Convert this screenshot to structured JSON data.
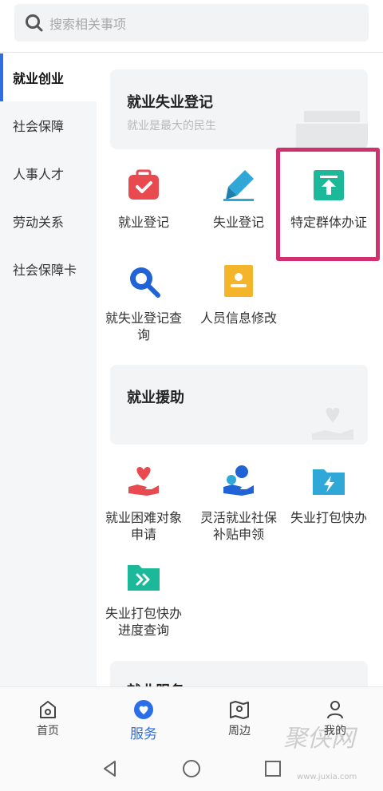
{
  "search": {
    "placeholder": "搜索相关事项"
  },
  "sidebar": {
    "items": [
      {
        "label": "就业创业"
      },
      {
        "label": "社会保障"
      },
      {
        "label": "人事人才"
      },
      {
        "label": "劳动关系"
      },
      {
        "label": "社会保障卡"
      }
    ]
  },
  "sections": {
    "registration": {
      "title": "就业失业登记",
      "subtitle": "就业是最大的民生",
      "items": [
        {
          "label": "就业登记",
          "icon": "briefcase-check-icon"
        },
        {
          "label": "失业登记",
          "icon": "pen-icon"
        },
        {
          "label": "特定群体办证",
          "icon": "upload-box-icon"
        },
        {
          "label": "就失业登记查询",
          "icon": "magnifier-icon"
        },
        {
          "label": "人员信息修改",
          "icon": "id-card-icon"
        }
      ]
    },
    "assistance": {
      "title": "就业援助",
      "items": [
        {
          "label": "就业困难对象申请",
          "icon": "hand-heart-icon"
        },
        {
          "label": "灵活就业社保补贴申领",
          "icon": "hand-coin-icon"
        },
        {
          "label": "失业打包快办",
          "icon": "folder-lightning-icon"
        },
        {
          "label": "失业打包快办进度查询",
          "icon": "folder-forward-icon"
        }
      ]
    },
    "service": {
      "title": "就业服务"
    }
  },
  "tabbar": {
    "tabs": [
      {
        "label": "首页"
      },
      {
        "label": "服务"
      },
      {
        "label": "周边"
      },
      {
        "label": "我的"
      }
    ]
  },
  "colors": {
    "accent_blue": "#2b6ee8",
    "highlight_pink": "#d1306f",
    "icon_red": "#e84a50",
    "icon_teal": "#1bb89a",
    "icon_cyan": "#2fa8d8",
    "icon_yellow": "#f5b52a"
  }
}
